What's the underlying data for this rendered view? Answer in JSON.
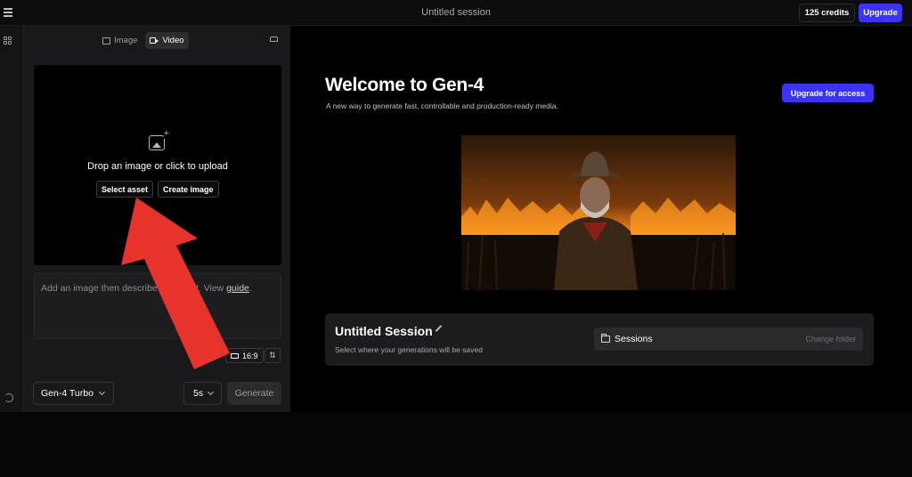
{
  "topbar": {
    "session_title": "Untitled session",
    "credits": "125 credits",
    "upgrade_label": "Upgrade"
  },
  "left_panel": {
    "tabs": [
      {
        "label": "Image",
        "active": false
      },
      {
        "label": "Video",
        "active": true
      }
    ],
    "dropzone": {
      "text": "Drop an image or click to upload",
      "select_asset": "Select asset",
      "create_image": "Create image"
    },
    "prompt": {
      "text_before": "Add an image then describe your shot. View ",
      "link": "guide",
      "text_after": "."
    },
    "aspect_ratio": "16:9",
    "model": "Gen-4 Turbo",
    "duration": "5s",
    "generate_label": "Generate"
  },
  "main": {
    "title": "Welcome to Gen-4",
    "subtitle": "A new way to generate fast, controllable and production-ready media.",
    "access_button": "Upgrade for access",
    "session_card": {
      "title": "Untitled Session",
      "subtitle": "Select where your generations will be saved",
      "folder_label": "Sessions",
      "change_folder": "Change folder"
    }
  },
  "colors": {
    "accent": "#3b34f5",
    "annotation_arrow": "#e8322c"
  },
  "icons": [
    "menu-icon",
    "grid-icon",
    "image-icon",
    "video-icon",
    "graduation-cap-icon",
    "upload-image-icon",
    "aspect-ratio-icon",
    "settings-sliders-icon",
    "history-icon",
    "chevron-down-icon",
    "pencil-icon",
    "folder-icon"
  ]
}
